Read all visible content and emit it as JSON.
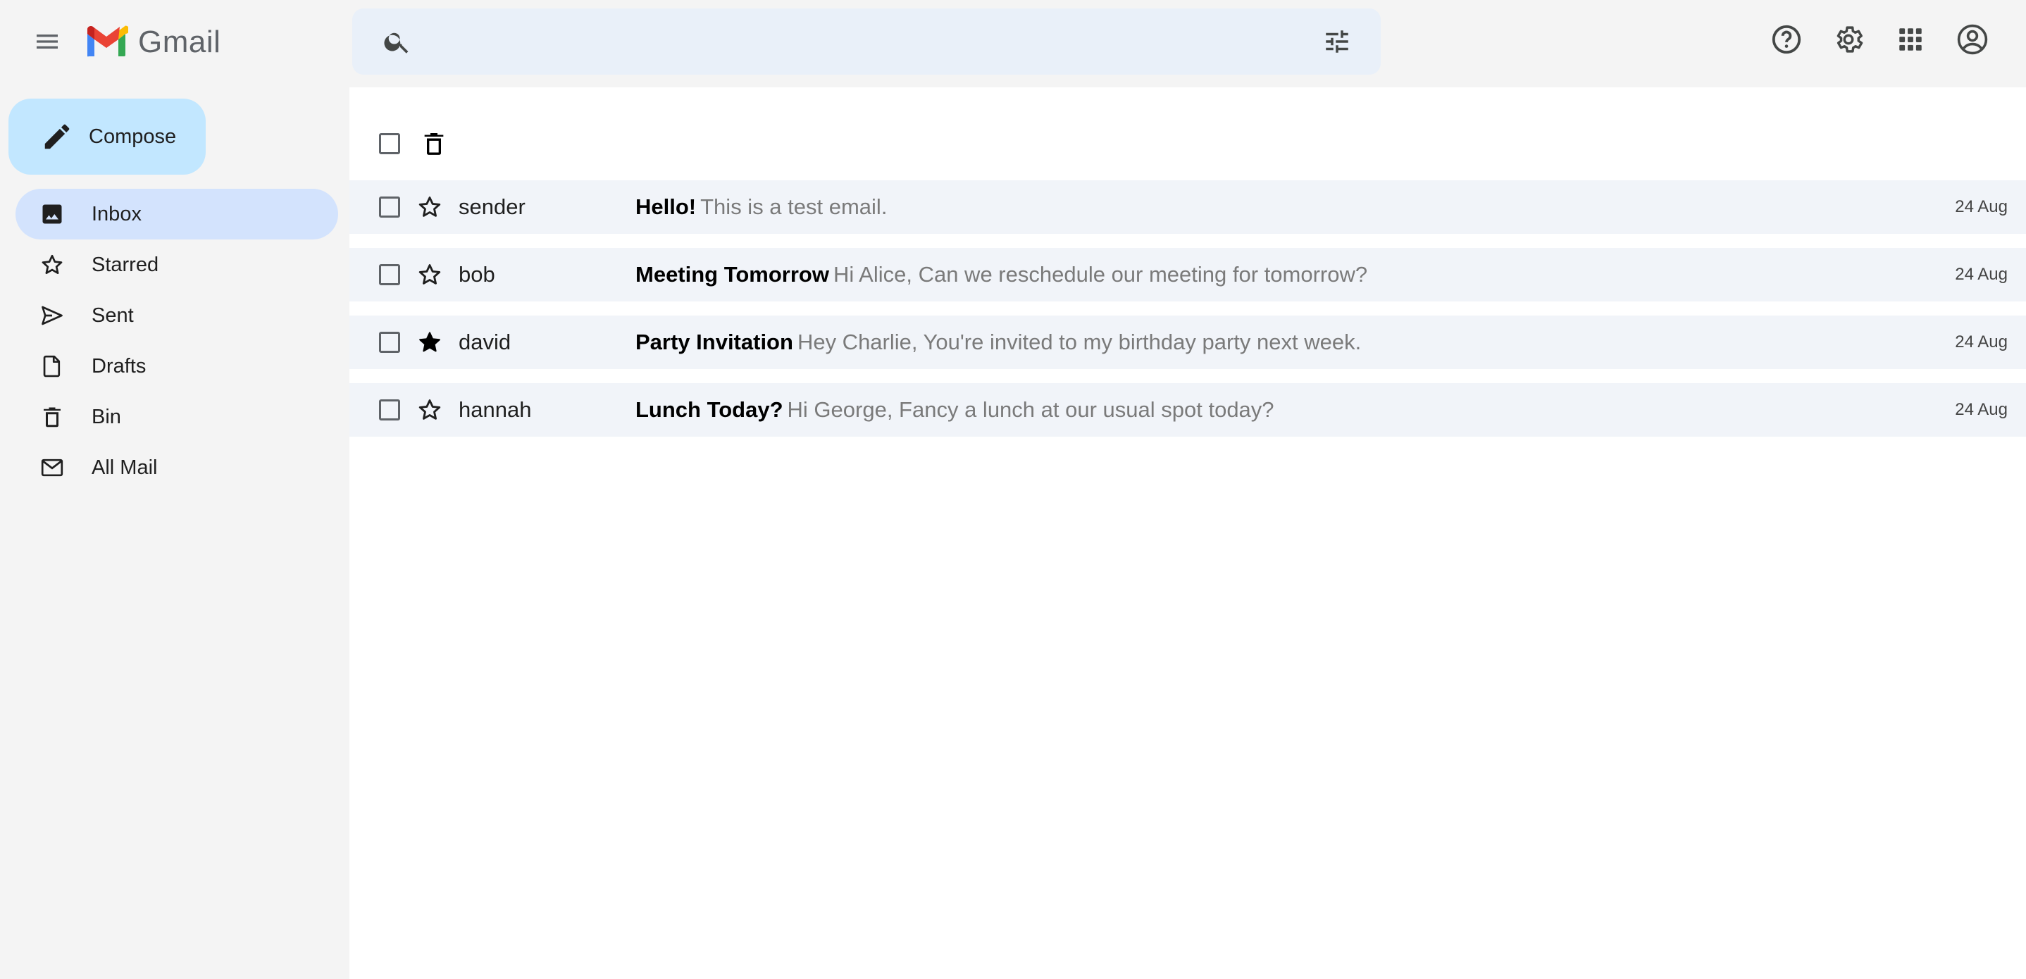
{
  "app": {
    "name": "Gmail"
  },
  "colors": {
    "compose_bg": "#c2e7ff",
    "active_nav_bg": "#d3e3fd",
    "search_bg": "#e9f0f9",
    "row_bg": "#f1f4f9",
    "gmail_red": "#ea4335",
    "gmail_blue": "#4285f4",
    "gmail_green": "#34a853",
    "gmail_yellow": "#fbbc04"
  },
  "header": {
    "menu_icon": "hamburger-menu-icon",
    "search": {
      "placeholder": "",
      "value": ""
    },
    "icons": [
      "help-icon",
      "settings-gear-icon",
      "apps-grid-icon",
      "account-circle-icon"
    ]
  },
  "sidebar": {
    "compose_label": "Compose",
    "items": [
      {
        "label": "Inbox",
        "icon": "inbox-icon",
        "active": true
      },
      {
        "label": "Starred",
        "icon": "star-outline-icon",
        "active": false
      },
      {
        "label": "Sent",
        "icon": "send-icon",
        "active": false
      },
      {
        "label": "Drafts",
        "icon": "draft-file-icon",
        "active": false
      },
      {
        "label": "Bin",
        "icon": "trash-icon",
        "active": false
      },
      {
        "label": "All Mail",
        "icon": "mail-envelope-icon",
        "active": false
      }
    ]
  },
  "emails": [
    {
      "sender": "sender",
      "subject": "Hello!",
      "snippet": "This is a test email.",
      "date": "24 Aug",
      "starred": false
    },
    {
      "sender": "bob",
      "subject": "Meeting Tomorrow",
      "snippet": "Hi Alice, Can we reschedule our meeting for tomorrow?",
      "date": "24 Aug",
      "starred": false
    },
    {
      "sender": "david",
      "subject": "Party Invitation",
      "snippet": "Hey Charlie, You're invited to my birthday party next week.",
      "date": "24 Aug",
      "starred": true
    },
    {
      "sender": "hannah",
      "subject": "Lunch Today?",
      "snippet": "Hi George, Fancy a lunch at our usual spot today?",
      "date": "24 Aug",
      "starred": false
    }
  ]
}
